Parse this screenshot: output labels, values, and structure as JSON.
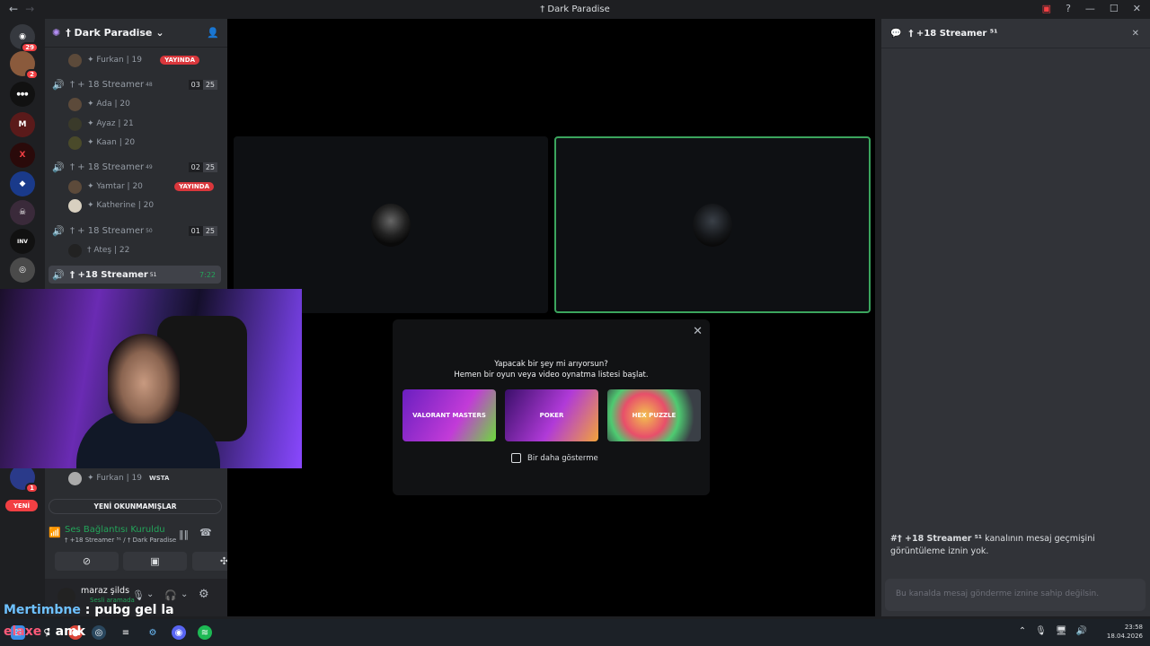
{
  "window": {
    "title": "† Dark Paradise"
  },
  "server": {
    "name": "† Dark Paradise"
  },
  "servers": [
    {
      "name": "discord-home",
      "badge": "29"
    },
    {
      "name": "server-2",
      "badge": "2"
    },
    {
      "name": "server-3",
      "badge": ""
    },
    {
      "name": "server-4",
      "badge": ""
    },
    {
      "name": "server-5",
      "badge": ""
    },
    {
      "name": "server-6",
      "badge": ""
    },
    {
      "name": "server-7",
      "badge": ""
    },
    {
      "name": "server-8",
      "badge": ""
    },
    {
      "name": "server-9",
      "badge": ""
    },
    {
      "name": "server-10",
      "badge": "1"
    }
  ],
  "channels": {
    "top_user": {
      "name": "✦ Furkan | 19",
      "status": "YAYINDA"
    },
    "ch1": {
      "name": "† + 18 Streamer",
      "sup": "48",
      "c1": "03",
      "c2": "25",
      "users": [
        "✦ Ada | 20",
        "✦ Ayaz | 21",
        "✦ Kaan | 20"
      ]
    },
    "ch2": {
      "name": "† + 18 Streamer",
      "sup": "49",
      "c1": "02",
      "c2": "25",
      "users": [
        "✦ Yamtar | 20",
        "✦ Katherine | 20"
      ],
      "live": "YAYINDA"
    },
    "ch3": {
      "name": "† + 18 Streamer",
      "sup": "50",
      "c1": "01",
      "c2": "25",
      "users": [
        "† Ateş | 22"
      ]
    },
    "ch4": {
      "name": "† +18 Streamer",
      "sup": "51",
      "time": "7:22"
    },
    "bottom_user": {
      "name": "✦ Furkan | 19",
      "tag": "WSTA"
    }
  },
  "new_label": "YENİ",
  "unread_label": "YENİ OKUNMAMIŞLAR",
  "voice": {
    "status": "Ses Bağlantısı Kuruldu",
    "sub": "† +18 Streamer ⁵¹ / † Dark Paradise"
  },
  "user": {
    "name": "maraz şilds",
    "status": "Sesli aramada"
  },
  "activity": {
    "line1": "Yapacak bir şey mi arıyorsun?",
    "line2": "Hemen bir oyun veya video oynatma listesi başlat.",
    "cards": [
      "VALORANT MASTERS",
      "POKER",
      "HEX PUZZLE"
    ],
    "checkbox": "Bir daha gösterme"
  },
  "right_panel": {
    "title": "† +18 Streamer ⁵¹",
    "message_bold": "#† +18 Streamer ⁵¹",
    "message_rest": " kanalının mesaj geçmişini görüntüleme iznin yok.",
    "input_placeholder": "Bu kanalda mesaj gönderme iznine sahip değilsin."
  },
  "overlay_chat": [
    {
      "user": "Mertimbne",
      "text": " : pubg gel la",
      "color": "#6ec1ff"
    },
    {
      "user": "elaxe",
      "text": " : amk",
      "color": "#ff5a7a"
    }
  ],
  "taskbar": {
    "time": "23:58",
    "date": "18.04.2026"
  }
}
